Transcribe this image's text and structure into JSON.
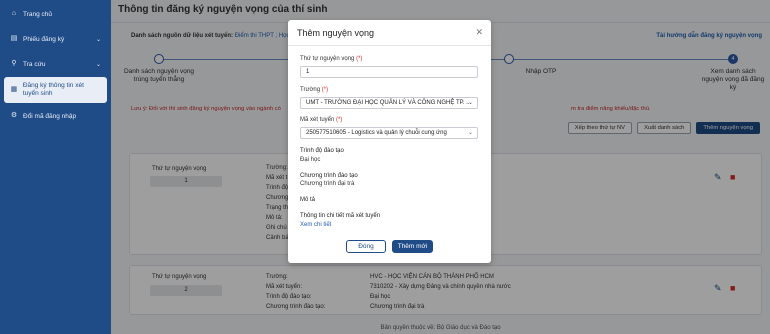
{
  "sidebar": {
    "items": [
      {
        "label": "Trang chủ",
        "icon": "home-icon"
      },
      {
        "label": "Phiếu đăng ký",
        "icon": "document-icon",
        "chevron": true
      },
      {
        "label": "Tra cứu",
        "icon": "search-icon",
        "chevron": true
      },
      {
        "label": "Đăng ký thông tin xét tuyển sinh",
        "icon": "clipboard-icon",
        "active": true
      },
      {
        "label": "Đổi mã đăng nhập",
        "icon": "key-icon"
      }
    ]
  },
  "main": {
    "title": "Thông tin đăng ký nguyện vọng của thí sinh",
    "source_label": "Danh sách nguồn dữ liệu xét tuyển:",
    "source_value": "Điểm thi THPT ; Học",
    "guide_link": "Tài hướng dẫn đăng ký nguyện vọng",
    "steps": [
      {
        "num": "1",
        "label": "Danh sách nguyện vọng trúng tuyển thẳng"
      },
      {
        "num": "3",
        "label": "Nhập OTP"
      },
      {
        "num": "4",
        "label": "Xem danh sách nguyện vọng đã đăng ký"
      }
    ],
    "note_start": "Lưu ý: Đối với thí sinh đăng ký nguyện vọng vào ngành có",
    "note_end": "m tra điểm năng khiếu/đặc thù.",
    "buttons": {
      "sort": "Xếp theo thứ tự NV",
      "export": "Xuất danh sách",
      "add": "Thêm nguyện vọng"
    },
    "cards": [
      {
        "order_label": "Thứ tự nguyện vọng",
        "order_value": "1",
        "keys": [
          "Trường:",
          "Mã xét t",
          "Trình độ",
          "Chương",
          "Trạng th",
          "Mô tả:",
          "Ghi chú",
          "Cảnh bá"
        ],
        "values": []
      },
      {
        "order_label": "Thứ tự nguyện vọng",
        "order_value": "2",
        "keys": [
          "Trường:",
          "Mã xét tuyển:",
          "Trình độ đào tạo:",
          "Chương trình đào tạo:"
        ],
        "values": [
          "HVC - HỌC VIỆN CÁN BỘ THÀNH PHỐ HCM",
          "7310202 - Xây dựng Đảng và chính quyền nhà nước",
          "Đại học",
          "Chương trình đại trà"
        ]
      }
    ],
    "footer": "Bản quyền thuộc về: Bộ Giáo dục và Đào tạo"
  },
  "modal": {
    "title": "Thêm nguyện vọng",
    "order_label": "Thứ tự nguyện vọng",
    "order_value": "1",
    "school_label": "Trường",
    "school_value": "UMT - TRƯỜNG ĐẠI HỌC QUẢN LÝ VÀ CÔNG NGHỆ TP. ...",
    "code_label": "Mã xét tuyển",
    "code_value": "250577510605 - Logistics và quản lý chuỗi cung ứng",
    "req": "(*)",
    "level_label": "Trình độ đào tạo",
    "level_value": "Đại học",
    "program_label": "Chương trình đào tạo",
    "program_value": "Chương trình đại trà",
    "desc_label": "Mô tả",
    "detail_label": "Thông tin chi tiết mã xét tuyển",
    "detail_link": "Xem chi tiết",
    "cancel": "Đóng",
    "submit": "Thêm mới"
  }
}
